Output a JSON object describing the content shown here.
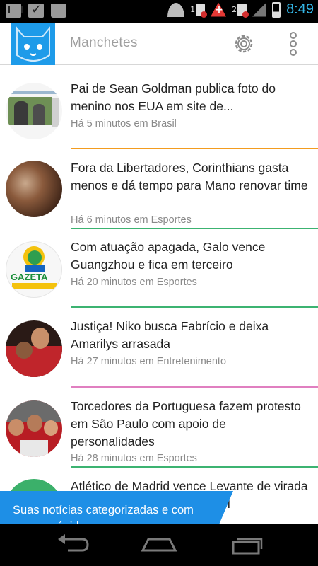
{
  "status_bar": {
    "time": "8:49",
    "sim1": "1",
    "sim2": "2",
    "icons": [
      "gmail-icon",
      "check-icon",
      "shopping-bag-icon",
      "wifi-icon",
      "sim-icon",
      "alert-icon",
      "sim-icon",
      "signal-icon",
      "battery-icon"
    ]
  },
  "app_bar": {
    "title": "Manchetes",
    "logo": "owl-logo-icon",
    "settings_icon": "gear-icon",
    "menu_icon": "overflow-menu-icon",
    "accent": "#1e9be9"
  },
  "news": [
    {
      "headline": "Pai de Sean Goldman publica foto do menino nos EUA em site de...",
      "meta": "Há 5 minutos em Brasil",
      "divider_color": "#f39c1f"
    },
    {
      "headline": "Fora da Libertadores, Corinthians gasta menos e dá tempo para Mano renovar time",
      "meta": "Há 6 minutos em Esportes",
      "divider_color": "#3cb371"
    },
    {
      "headline": "Com atuação apagada, Galo vence Guangzhou e fica em terceiro",
      "meta": "Há 20 minutos em Esportes",
      "thumb_text": "GAZETA",
      "divider_color": "#3cb371"
    },
    {
      "headline": "Justiça! Niko busca Fabrício e deixa Amarilys arrasada",
      "meta": "Há 27 minutos em Entretenimento",
      "divider_color": "#e07fc0"
    },
    {
      "headline": "Torcedores da Portuguesa fazem protesto em São Paulo com apoio de personalidades",
      "meta": "Há 28 minutos em Esportes",
      "divider_color": "#3cb371"
    },
    {
      "headline": "Atlético de Madrid vence Levante de virada e é líder isolado do Espanhol",
      "meta": "",
      "divider_color": ""
    }
  ],
  "toast": {
    "text": "Suas notícias categorizadas e com acesso rápido.",
    "color": "#1e8fe6"
  },
  "nav_bar": {
    "icons": [
      "back-icon",
      "home-icon",
      "recent-apps-icon"
    ]
  }
}
